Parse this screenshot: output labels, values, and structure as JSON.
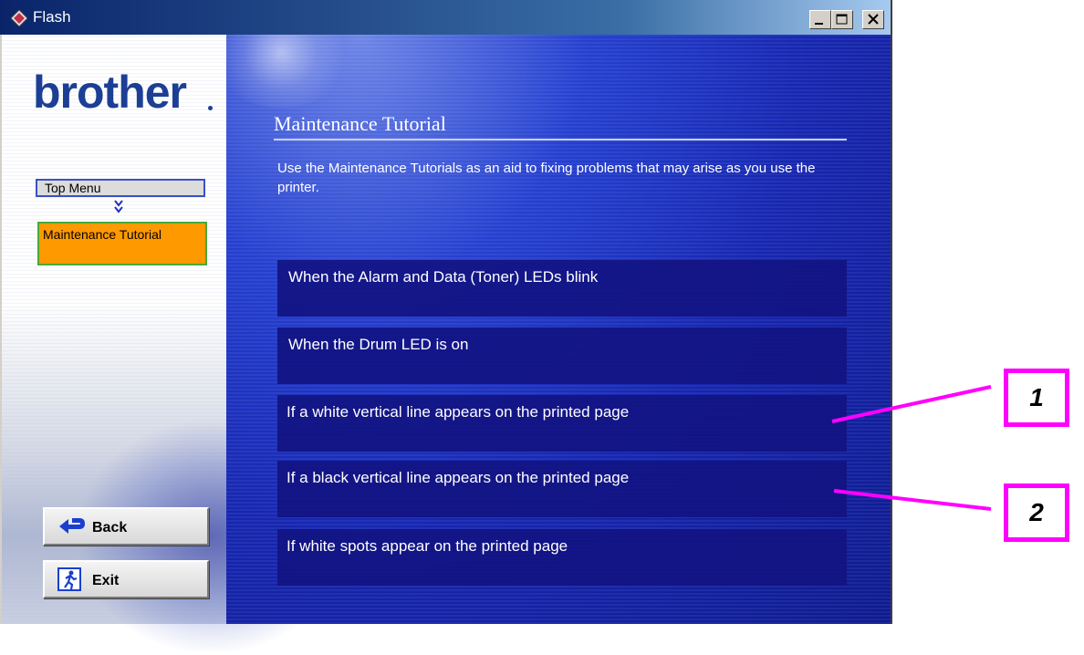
{
  "window": {
    "title": "Flash",
    "controls": [
      "minimize-icon",
      "maximize-icon",
      "close-icon"
    ]
  },
  "sidebar": {
    "logo": "brother",
    "breadcrumb": {
      "top": "Top Menu",
      "current": "Maintenance Tutorial"
    },
    "buttons": {
      "back": "Back",
      "exit": "Exit"
    }
  },
  "main": {
    "title": "Maintenance Tutorial",
    "description": "Use the Maintenance Tutorials as an aid to fixing problems that may arise as you use the printer.",
    "items": [
      "When the Alarm and Data (Toner) LEDs blink",
      "When the Drum LED is on",
      "If a white vertical line appears on the printed page",
      "If a black vertical line appears on the printed page",
      "If white spots appear on the printed page"
    ]
  },
  "callouts": [
    "1",
    "2"
  ],
  "colors": {
    "callout_border": "#ff00ff",
    "brand_blue": "#1c3f95",
    "current_crumb": "#ff9900"
  }
}
